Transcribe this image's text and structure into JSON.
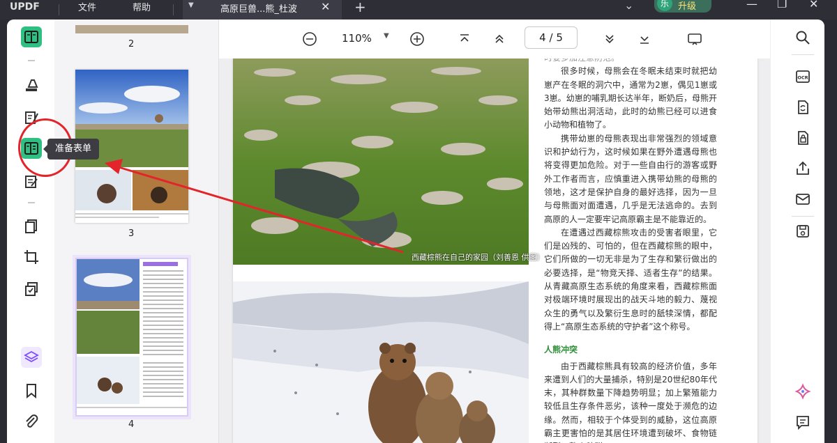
{
  "titlebar": {
    "logo": "UPDF",
    "menu": [
      "文件",
      "帮助"
    ],
    "tab_title": "高原巨兽...熊_杜波",
    "upgrade_avatar": "乐",
    "upgrade_label": "升级"
  },
  "left_toolbar": {
    "items": [
      {
        "name": "reader",
        "icon": "book-icon"
      },
      {
        "name": "comment",
        "icon": "highlighter-icon"
      },
      {
        "name": "edit",
        "icon": "edit-text-icon"
      },
      {
        "name": "prepare-form",
        "icon": "form-icon",
        "active": true
      },
      {
        "name": "fill-sign",
        "icon": "sign-icon"
      },
      {
        "name": "organize",
        "icon": "pages-icon"
      },
      {
        "name": "crop",
        "icon": "crop-icon"
      },
      {
        "name": "redact",
        "icon": "redact-icon"
      },
      {
        "name": "layers",
        "icon": "layers-icon"
      },
      {
        "name": "bookmark",
        "icon": "bookmark-icon"
      },
      {
        "name": "attachment",
        "icon": "paperclip-icon"
      }
    ],
    "tooltip": "准备表单"
  },
  "thumbnails": {
    "pages": [
      {
        "number": "2"
      },
      {
        "number": "3"
      },
      {
        "number": "4",
        "selected": true
      }
    ]
  },
  "view_toolbar": {
    "zoom": "110%",
    "page_current": "4",
    "page_total": "5",
    "page_sep": "/"
  },
  "document": {
    "caption": "西藏棕熊在自己的家园（刘善恩 供图）",
    "top_partial": "时要多加注意防范。",
    "paragraphs": [
      "很多时候，母熊会在冬眠未结束时就把幼崽产在冬眠的洞穴中，通常为2崽，偶见1崽或3崽。幼崽的哺乳期长达半年，断奶后，母熊开始带幼熊出洞活动，此时的幼熊已经可以进食小动物和植物了。",
      "携带幼崽的母熊表现出非常强烈的领域意识和护幼行为，这时候如果在野外遭遇母熊也将变得更加危险。对于一些自由行的游客或野外工作者而言，应慎重进入携带幼熊的母熊的领地，这才是保护自身的最好选择，因为一旦与母熊面对面遭遇，几乎是无法逃命的。去到高原的人一定要牢记高原霸主是不能靠近的。",
      "在遭遇过西藏棕熊攻击的受害者眼里，它们是凶残的、可怕的，但在西藏棕熊的眼中，它们所做的一切无非是为了生存和繁衍做出的必要选择，是“物竞天择、适者生存”的结果。从青藏高原生态系统的角度来看，西藏棕熊面对极端环境时展现出的战天斗地的毅力、蔑视众生的勇气以及繁衍生息时的舐犊深情，都配得上“高原生态系统的守护者”这个称号。"
    ],
    "heading": "人熊冲突",
    "paragraphs2": [
      "由于西藏棕熊具有较高的经济价值，多年来遭到人们的大量捕杀，特别是20世纪80年代末，其种群数量下降趋势明显；加上繁殖能力较低且生存条件恶劣，该种一度处于濒危的边缘。然而，相较于个体受到的威胁，这位高原霸主更害怕的是其居住环境遭到破坏、食物链断裂，整个种群"
    ]
  },
  "right_toolbar": {
    "items": [
      "search-icon",
      "ocr-icon",
      "convert-icon",
      "protect-icon",
      "share-icon",
      "email-icon",
      "save-icon",
      "ai-assistant-icon",
      "comment-list-icon"
    ]
  },
  "colors": {
    "accent_green": "#2fbf82",
    "annotation_red": "#e3242b",
    "titlebar_bg": "#2e2e36"
  }
}
